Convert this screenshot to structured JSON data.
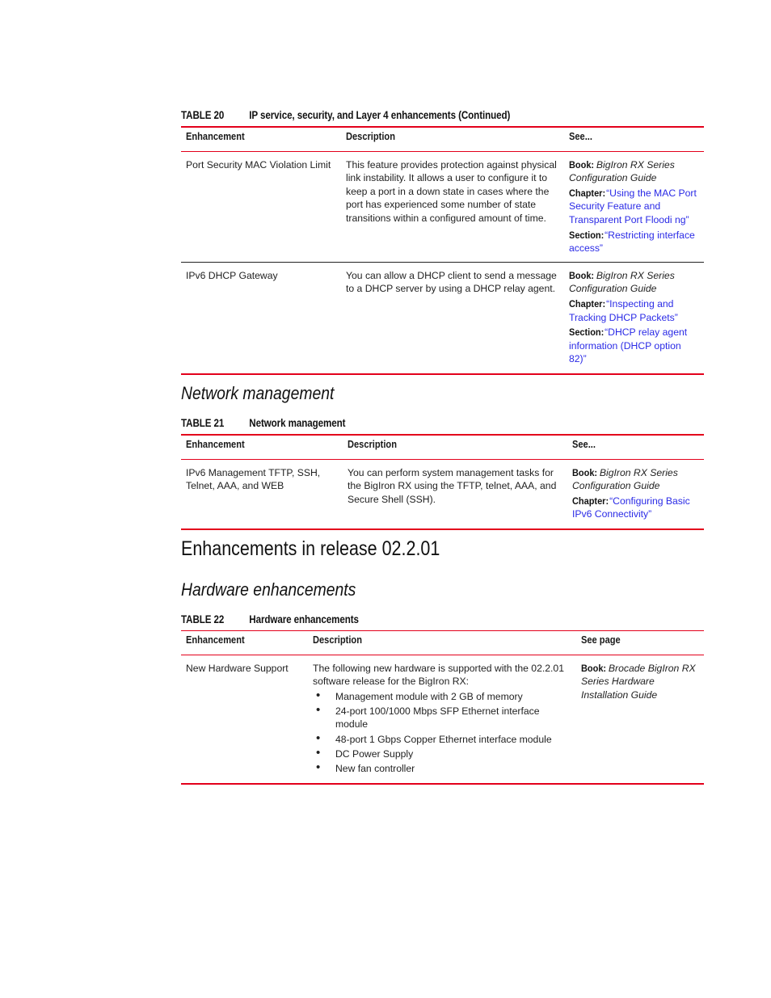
{
  "table20": {
    "number": "TABLE 20",
    "title": "IP service, security, and Layer 4 enhancements (Continued)",
    "headers": [
      "Enhancement",
      "Description",
      "See..."
    ],
    "rows": [
      {
        "enhancement": "Port Security MAC Violation Limit",
        "description": "This feature provides protection against physical link instability. It allows a user to configure it to keep a port in a down state in cases where the port has experienced some number of state transitions within a configured amount of time.",
        "book_label": "Book:",
        "book": "BigIron RX Series Configuration Guide",
        "chapter_label": "Chapter:",
        "chapter": "“Using the MAC Port Security Feature and Transparent Port Floodi ng”",
        "section_label": "Section:",
        "section": "“Restricting interface access”"
      },
      {
        "enhancement": "IPv6 DHCP Gateway",
        "description": "You can allow a DHCP client to send a message to a DHCP server by using a DHCP relay agent.",
        "book_label": "Book:",
        "book": "BigIron RX Series Configuration Guide",
        "chapter_label": "Chapter:",
        "chapter": "“Inspecting and Tracking DHCP Packets”",
        "section_label": "Section:",
        "section": "“DHCP relay agent information (DHCP option 82)”"
      }
    ]
  },
  "network_management": {
    "heading": "Network management",
    "table": {
      "number": "TABLE 21",
      "title": "Network management",
      "headers": [
        "Enhancement",
        "Description",
        "See..."
      ],
      "rows": [
        {
          "enhancement": "IPv6 Management TFTP, SSH, Telnet, AAA, and WEB",
          "description": "You can perform system management tasks for the BigIron RX using the TFTP, telnet, AAA, and Secure Shell (SSH).",
          "book_label": "Book:",
          "book": "BigIron RX Series Configuration Guide",
          "chapter_label": "Chapter:",
          "chapter": "“Configuring Basic IPv6 Connectivity”"
        }
      ]
    }
  },
  "release": {
    "heading": "Enhancements in release 02.2.01",
    "subheading": "Hardware enhancements",
    "table": {
      "number": "TABLE 22",
      "title": "Hardware enhancements",
      "headers": [
        "Enhancement",
        "Description",
        "See page"
      ],
      "rows": [
        {
          "enhancement": "New Hardware Support",
          "description": "The following new hardware is supported with the 02.2.01 software release for the BigIron RX:",
          "bullets": [
            "Management module with 2 GB of memory",
            "24-port 100/1000 Mbps SFP Ethernet interface module",
            "48-port 1 Gbps Copper Ethernet interface module",
            "DC Power Supply",
            "New fan controller"
          ],
          "book_label": "Book:",
          "book": "Brocade BigIron RX Series Hardware Installation Guide"
        }
      ]
    }
  },
  "colors": {
    "rule_red": "#e3001b",
    "link_blue": "#2a2ae6"
  }
}
